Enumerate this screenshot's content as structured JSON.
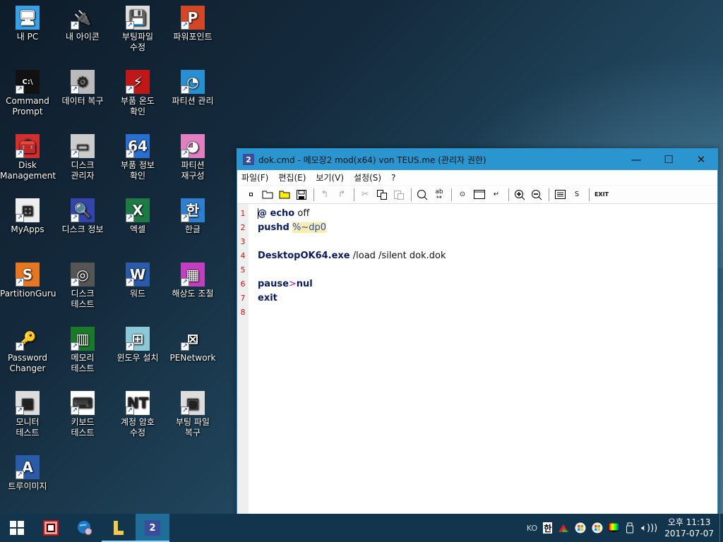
{
  "desktop": {
    "icons": [
      {
        "label": "내 PC",
        "icon": "computer-icon"
      },
      {
        "label": "내 아이콘",
        "icon": "usb-plug-icon"
      },
      {
        "label": "부팅파일\n수정",
        "icon": "floppy-edit-icon"
      },
      {
        "label": "파워포인트",
        "icon": "powerpoint-icon"
      },
      {
        "label": "Command\nPrompt",
        "icon": "cmd-icon"
      },
      {
        "label": "데이터 복구",
        "icon": "data-recovery-icon"
      },
      {
        "label": "부품 온도\n확인",
        "icon": "temperature-icon"
      },
      {
        "label": "파티션 관리",
        "icon": "partition-manager-icon"
      },
      {
        "label": "Disk\nManagement",
        "icon": "disk-management-icon"
      },
      {
        "label": "디스크\n관리자",
        "icon": "disk-manager-icon"
      },
      {
        "label": "부품 정보\n확인",
        "icon": "cpu-info-64-icon"
      },
      {
        "label": "파티션\n재구성",
        "icon": "partition-pie-icon"
      },
      {
        "label": "MyApps",
        "icon": "windows-orb-icon"
      },
      {
        "label": "디스크 정보",
        "icon": "disk-info-icon"
      },
      {
        "label": "엑셀",
        "icon": "excel-icon"
      },
      {
        "label": "한글",
        "icon": "hangul-icon"
      },
      {
        "label": "PartitionGuru",
        "icon": "partitionguru-icon"
      },
      {
        "label": "디스크\n테스트",
        "icon": "hdd-test-icon"
      },
      {
        "label": "워드",
        "icon": "word-icon"
      },
      {
        "label": "해상도 조절",
        "icon": "display-resolution-icon"
      },
      {
        "label": "Password\nChanger",
        "icon": "key-icon"
      },
      {
        "label": "메모리\n테스트",
        "icon": "memory-test-icon"
      },
      {
        "label": "윈도우 설치",
        "icon": "windows-setup-icon"
      },
      {
        "label": "PENetwork",
        "icon": "network-icon"
      },
      {
        "label": "모니터\n테스트",
        "icon": "monitor-test-icon"
      },
      {
        "label": "키보드\n테스트",
        "icon": "keyboard-icon"
      },
      {
        "label": "계정 암호\n수정",
        "icon": "nt-password-icon"
      },
      {
        "label": "부팅 파일\n복구",
        "icon": "boot-repair-icon"
      },
      {
        "label": "트루이미지",
        "icon": "trueimage-icon"
      }
    ]
  },
  "window": {
    "title": "dok.cmd - 메모장2 mod(x64) von TEUS.me (관리자 권한)",
    "app_icon_text": "2",
    "controls": {
      "minimize": "—",
      "maximize": "☐",
      "close": "✕"
    },
    "menu": [
      "파일(F)",
      "편집(E)",
      "보기(V)",
      "설정(S)",
      "?"
    ],
    "toolbar": {
      "exit_label": "EXIT",
      "s_label": "S"
    },
    "editor": {
      "line_numbers": [
        "1",
        "2",
        "3",
        "4",
        "5",
        "6",
        "7",
        "8"
      ],
      "lines": [
        {
          "parts": [
            {
              "t": "@ ",
              "c": "kw"
            },
            {
              "t": "echo",
              "c": "kw"
            },
            {
              "t": " off",
              "c": ""
            }
          ]
        },
        {
          "parts": [
            {
              "t": "pushd",
              "c": "kw"
            },
            {
              "t": " ",
              "c": ""
            },
            {
              "t": "%~dp0",
              "c": "var"
            }
          ]
        },
        {
          "parts": []
        },
        {
          "parts": [
            {
              "t": "DesktopOK64.exe",
              "c": "kw"
            },
            {
              "t": " /load /silent dok.dok",
              "c": ""
            }
          ]
        },
        {
          "parts": []
        },
        {
          "parts": [
            {
              "t": "pause",
              "c": "kw"
            },
            {
              "t": ">",
              "c": "op"
            },
            {
              "t": "nul",
              "c": "kw"
            }
          ]
        },
        {
          "parts": [
            {
              "t": "exit",
              "c": "kw"
            }
          ]
        },
        {
          "parts": []
        }
      ]
    }
  },
  "taskbar": {
    "apps": [
      {
        "name": "start-button"
      },
      {
        "name": "taskbar-app-red-tool"
      },
      {
        "name": "taskbar-app-browser"
      },
      {
        "name": "taskbar-app-explorer"
      },
      {
        "name": "taskbar-app-notepad2",
        "label": "2",
        "active": true
      }
    ],
    "tray": {
      "lang": "KO",
      "ime": "한",
      "time": "오후 11:13",
      "date": "2017-07-07"
    }
  },
  "colors": {
    "titlebar": "#2b95d0",
    "line_number": "#d21313",
    "keyword": "#0a1b5a",
    "variable_bg": "#fbecaa",
    "taskbar": "#12354d"
  }
}
